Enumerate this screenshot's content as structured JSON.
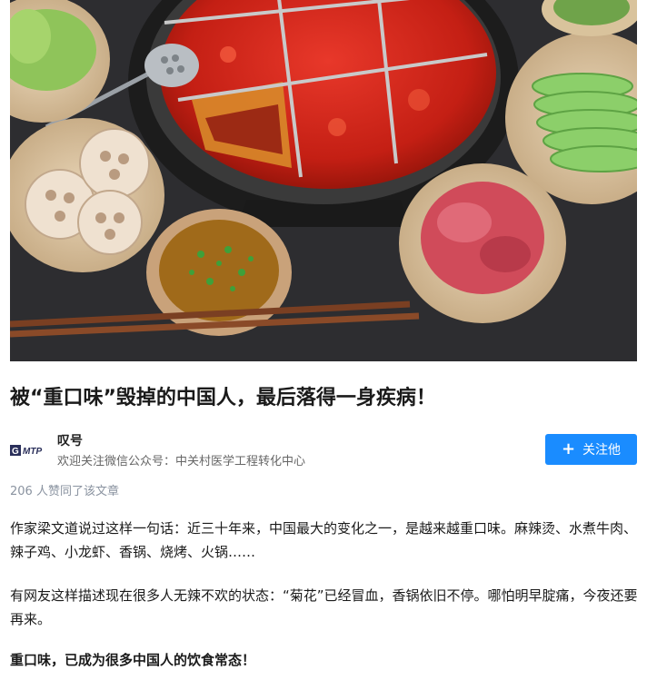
{
  "article": {
    "title": "被“重口味”毁掉的中国人，最后落得一身疾病！",
    "hero_image_alt": "hotpot"
  },
  "author": {
    "logo_text": "GMTP",
    "name": "叹号",
    "description": "欢迎关注微信公众号：中关村医学工程转化中心",
    "follow_label": "关注他",
    "follow_icon": "plus-icon"
  },
  "likes_text": "206 人赞同了该文章",
  "body": {
    "paragraphs": [
      "作家梁文道说过这样一句话：近三十年来，中国最大的变化之一，是越来越重口味。麻辣烫、水煮牛肉、辣子鸡、小龙虾、香锅、烧烤、火锅……",
      "有网友这样描述现在很多人无辣不欢的状态：“菊花”已经冒血，香锅依旧不停。哪怕明早腚痛，今夜还要再来。",
      "重口味，已成为很多中国人的饮食常态！"
    ]
  },
  "colors": {
    "accent": "#1a8cff",
    "muted": "#8a93a0"
  }
}
